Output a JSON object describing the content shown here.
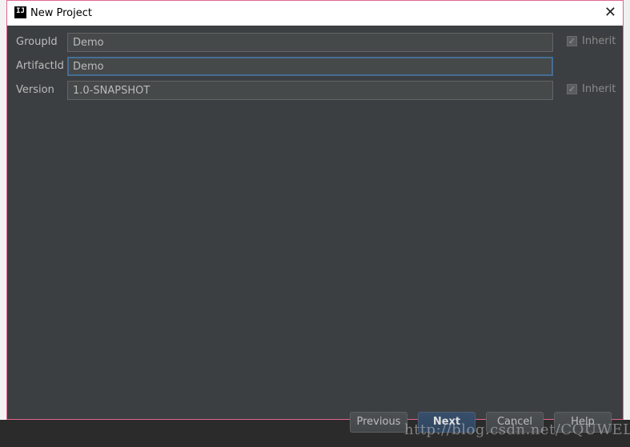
{
  "window": {
    "title": "New Project",
    "app_icon": "IJ"
  },
  "form": {
    "group_id": {
      "label": "GroupId",
      "value": "Demo",
      "inherit_label": "Inherit",
      "inherit_checked": true
    },
    "artifact_id": {
      "label": "ArtifactId",
      "value": "Demo"
    },
    "version": {
      "label": "Version",
      "value": "1.0-SNAPSHOT",
      "inherit_label": "Inherit",
      "inherit_checked": true
    }
  },
  "buttons": {
    "previous": "Previous",
    "next": "Next",
    "cancel": "Cancel",
    "help": "Help"
  },
  "watermark": "http://blog.csdn.net/CQUWEL",
  "colors": {
    "dialog_bg": "#3c3f41",
    "focus_border": "#466d94",
    "primary_button": "#384f6b"
  }
}
